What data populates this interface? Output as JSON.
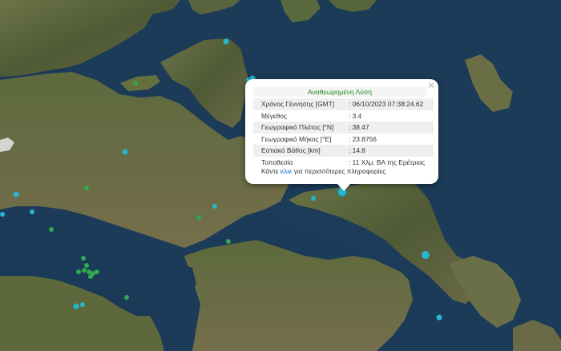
{
  "colors": {
    "sea": "#1b3a57",
    "land": "#5e6a3e",
    "quake_marker": "#27b6cf",
    "cluster_marker": "#2fa84f",
    "popup_title": "#1a8a1a",
    "link": "#1f6fc5"
  },
  "popup": {
    "title": "Αναθεωρημένη Λύση",
    "close_icon": "close-icon",
    "rows": [
      {
        "label": "Χρόνος Γέννησης [GMT]",
        "value": ": 06/10/2023 07:38:24.62"
      },
      {
        "label": "Μέγεθος",
        "value": ": 3.4"
      },
      {
        "label": "Γεωγραφικό Πλάτος [°N]",
        "value": ": 38.47"
      },
      {
        "label": "Γεωγραφικό Μήκος [°E]",
        "value": ": 23.8756"
      },
      {
        "label": "Εστιακό Βάθος [km]",
        "value": ": 14.8"
      },
      {
        "label": "Τοποθεσία",
        "value": ": 11 Χλμ. ΒΑ της Ερέτριας"
      }
    ],
    "more": {
      "prefix": "Κάντε ",
      "link": "κλικ",
      "suffix": " για περισσότερες πληροφορίες"
    }
  }
}
